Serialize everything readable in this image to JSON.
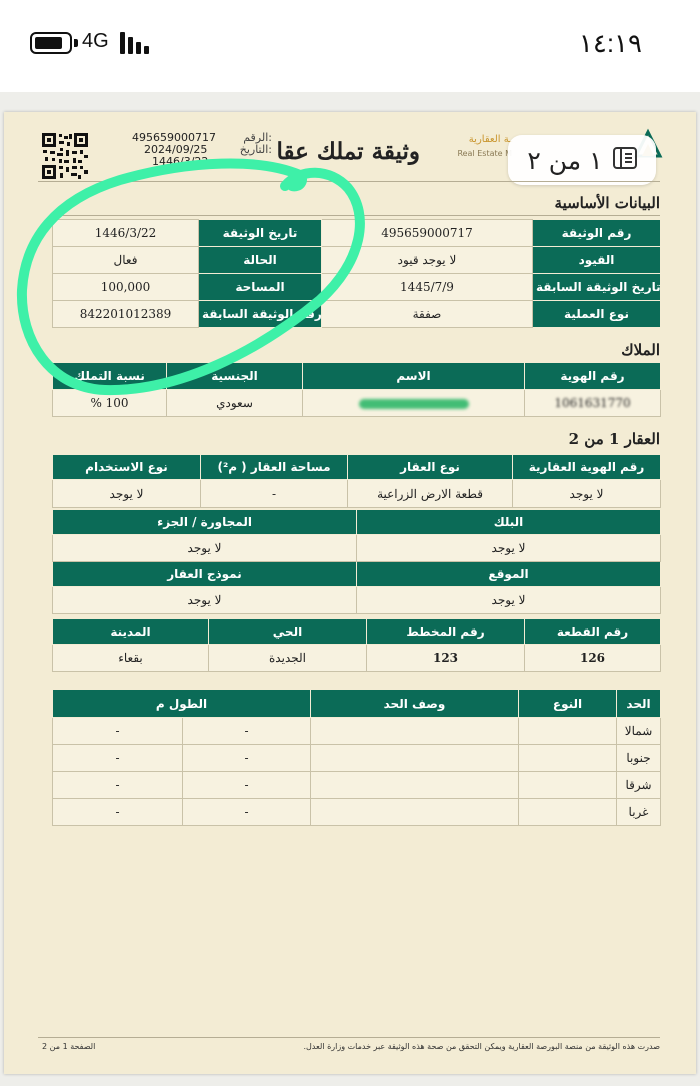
{
  "status_bar": {
    "network": "4G",
    "time": "١٤:١٩",
    "battery_level": 0.85
  },
  "viewer": {
    "page_indicator": "١ من ٢"
  },
  "header": {
    "title": "وثيقة تملك عقا",
    "logo_ar": "ـة العقارية",
    "logo_en": "Real Estate M",
    "meta": [
      {
        "label": "الرقم:",
        "value": "495659000717"
      },
      {
        "label": "التاريخ:",
        "value": "2024/09/25"
      },
      {
        "label": "",
        "value": "1446/3/22"
      }
    ]
  },
  "basic_info": {
    "title": "البيانات الأساسية",
    "rows": [
      {
        "right_label": "رقم الوثيقة",
        "right_value": "495659000717",
        "left_label": "تاريخ الوثيقة",
        "left_value": "1446/3/22"
      },
      {
        "right_label": "القيود",
        "right_value": "لا يوجد قيود",
        "left_label": "الحالة",
        "left_value": "فعال"
      },
      {
        "right_label": "تاريخ الوثيقة السابقة",
        "right_value": "1445/7/9",
        "left_label": "المساحة",
        "left_value": "100,000"
      },
      {
        "right_label": "نوع العملية",
        "right_value": "صفقة",
        "left_label": "رقم الوثيقة السابقة",
        "left_value": "842201012389"
      }
    ]
  },
  "owners": {
    "title": "الملاك",
    "headers": [
      "رقم الهوية",
      "الاسم",
      "الجنسية",
      "نسبة التملك"
    ],
    "row": {
      "id": "1061631770",
      "name": "",
      "nationality": "سعودي",
      "share": "100 %"
    }
  },
  "property": {
    "title": "العقار 1 من 2",
    "row1_headers": [
      "رقم الهوية العقارية",
      "نوع العقار",
      "مساحة العقار ( م²)",
      "نوع الاستخدام"
    ],
    "row1_values": [
      "لا يوجد",
      "قطعة الارض الزراعية",
      "-",
      "لا يوجد"
    ],
    "row2_headers": [
      "البلك",
      "المجاورة / الجزء"
    ],
    "row2_values": [
      "لا يوجد",
      "لا يوجد"
    ],
    "row3_headers": [
      "الموقع",
      "نموذج العقار"
    ],
    "row3_values": [
      "لا يوجد",
      "لا يوجد"
    ],
    "row4_headers": [
      "رقم القطعة",
      "رقم المخطط",
      "الحي",
      "المدينة"
    ],
    "row4_values": [
      "126",
      "123",
      "الجديدة",
      "بقعاء"
    ]
  },
  "boundaries": {
    "headers": [
      "الحد",
      "النوع",
      "وصف الحد",
      "الطول م"
    ],
    "rows": [
      {
        "side": "شمالا",
        "type": "",
        "desc": "-",
        "length": "-"
      },
      {
        "side": "جنوبا",
        "type": "",
        "desc": "-",
        "length": "-"
      },
      {
        "side": "شرقا",
        "type": "",
        "desc": "-",
        "length": "-"
      },
      {
        "side": "غربا",
        "type": "",
        "desc": "-",
        "length": "-"
      }
    ]
  },
  "footer": {
    "note": "صدرت هذه الوثيقة من منصة البورصة العقارية ويمكن التحقق من صحة هذه الوثيقة عبر خدمات وزارة العدل.",
    "page": "الصفحة 1 من 2"
  },
  "colors": {
    "header_green": "#0b6b57",
    "paper": "#f3ecd4",
    "annotation": "#3ef0a8"
  }
}
